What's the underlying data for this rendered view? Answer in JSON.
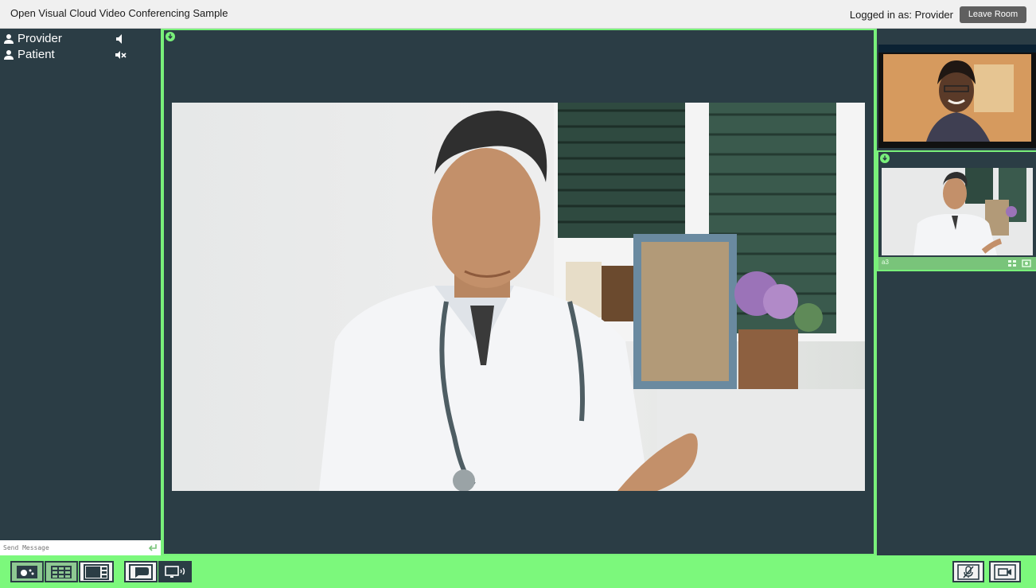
{
  "header": {
    "title": "Open Visual Cloud Video Conferencing Sample",
    "logged_in_text": "Logged in as: Provider",
    "leave_button": "Leave Room"
  },
  "sidebar": {
    "participants": [
      {
        "name": "Provider",
        "icon": "person-icon",
        "audio_icon": "speaker-icon"
      },
      {
        "name": "Patient",
        "icon": "person-icon",
        "audio_icon": "speaker-muted-icon"
      }
    ],
    "chat": {
      "placeholder": "Send Message",
      "send_icon": "send-icon"
    }
  },
  "main_stream": {
    "pin_icon": "pin-icon",
    "image": "doctor-video"
  },
  "right_panel": {
    "streams": [
      {
        "image": "patient-video"
      },
      {
        "image": "doctor-video-thumbnail",
        "pin_icon": "pin-icon",
        "label": "a3",
        "controls": [
          "fit-icon",
          "fullscreen-icon"
        ]
      }
    ]
  },
  "toolbar": {
    "left_buttons": [
      {
        "name": "speaker-view-button",
        "icon": "speaker-view-icon"
      },
      {
        "name": "gallery-view-button",
        "icon": "grid-view-icon"
      },
      {
        "name": "sidebar-view-button",
        "icon": "side-layout-icon"
      },
      {
        "name": "chat-button",
        "icon": "chat-icon"
      },
      {
        "name": "share-screen-button",
        "icon": "screen-share-icon"
      }
    ],
    "right_buttons": [
      {
        "name": "mute-mic-button",
        "icon": "mic-off-icon"
      },
      {
        "name": "camera-button",
        "icon": "camera-icon"
      }
    ]
  },
  "colors": {
    "accent_green": "#79f07a",
    "panel_dark": "#2b3d45",
    "toolbar_green": "#7cf87c",
    "leave_button_bg": "#5f5f5f"
  }
}
